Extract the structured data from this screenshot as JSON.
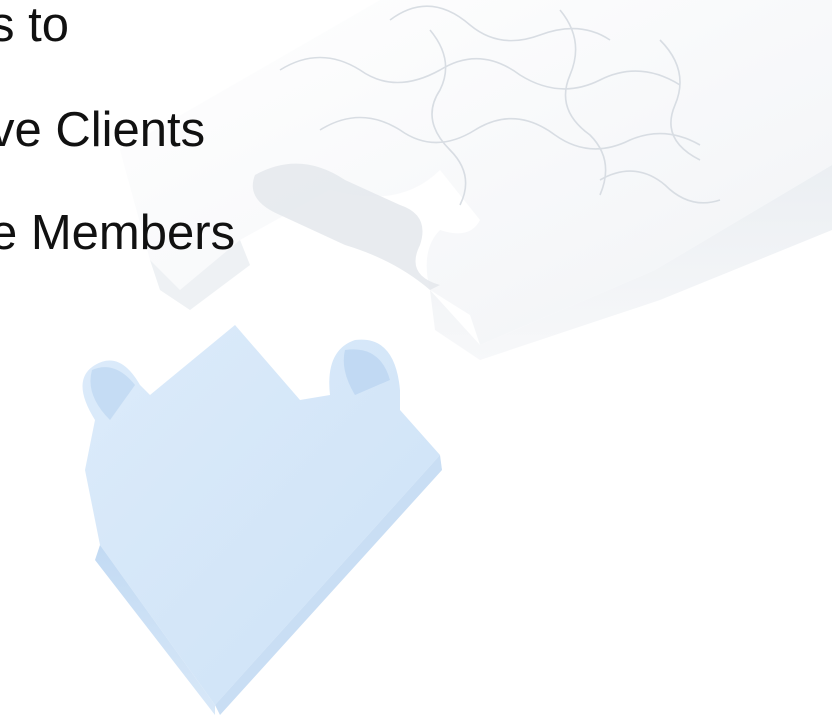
{
  "slide": {
    "lines": [
      "s to",
      "ve Clients",
      "e Members"
    ]
  },
  "colors": {
    "background": "#ffffff",
    "text": "#111111",
    "puzzle_white": "#f4f6f8",
    "puzzle_blue": "#cfe3f7"
  },
  "icons": {
    "assembled_puzzle": "puzzle-board-icon",
    "loose_piece": "puzzle-piece-icon"
  }
}
